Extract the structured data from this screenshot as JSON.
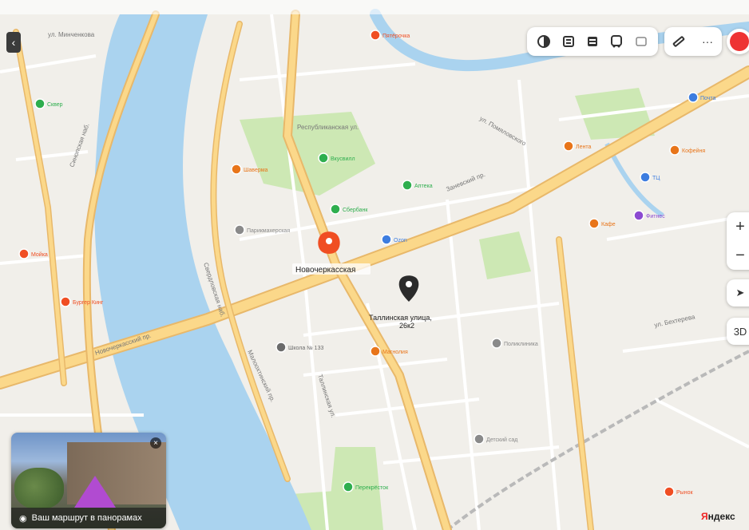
{
  "map": {
    "colors": {
      "land": "#f1efea",
      "water": "#aad3ef",
      "park": "#cde8b4",
      "road_major": "#fbd88a",
      "road_major_edge": "#e8b86a",
      "road_minor": "#ffffff",
      "rail": "#b9b9b9",
      "pin_red": "#f04e23",
      "pin_black": "#2b2b2b"
    },
    "streets": [
      {
        "name": "ул. Минченкова"
      },
      {
        "name": "Республиканская ул."
      },
      {
        "name": "Заневский пр."
      },
      {
        "name": "Новочеркасский пр."
      },
      {
        "name": "Синопская наб."
      },
      {
        "name": "Свердловская наб."
      },
      {
        "name": "Малоохтинский пр."
      },
      {
        "name": "ул. Помяловского"
      },
      {
        "name": "Таллинская ул."
      },
      {
        "name": "ул. Бехтерева"
      }
    ],
    "places": [
      {
        "label": "Бургер Кинг",
        "icon": "burger-icon",
        "color": "#f04e23"
      },
      {
        "label": "Мойка",
        "icon": "pin-icon",
        "color": "#f04e23"
      },
      {
        "label": "Шаверма",
        "icon": "pin-icon",
        "color": "#e8751a"
      },
      {
        "label": "Вкусвилл",
        "icon": "cart-icon",
        "color": "#2eae4e"
      },
      {
        "label": "Ozon",
        "icon": "box-icon",
        "color": "#3d7de0"
      },
      {
        "label": "Магнолия",
        "icon": "pin-icon",
        "color": "#e8751a"
      },
      {
        "label": "Лента",
        "icon": "cart-icon",
        "color": "#e8751a"
      },
      {
        "label": "Сбербанк",
        "icon": "bank-icon",
        "color": "#2eae4e"
      },
      {
        "label": "Пятёрочка",
        "icon": "cart-icon",
        "color": "#f04e23"
      },
      {
        "label": "Школа № 133",
        "icon": "school-icon",
        "color": "#6b6b6b"
      },
      {
        "label": "Детский сад",
        "icon": "pin-icon",
        "color": "#8a8a8a"
      },
      {
        "label": "Перекрёсток",
        "icon": "cart-icon",
        "color": "#2eae4e"
      },
      {
        "label": "Почта",
        "icon": "mail-icon",
        "color": "#3d7de0"
      },
      {
        "label": "Аптека",
        "icon": "pharmacy-icon",
        "color": "#2eae4e"
      },
      {
        "label": "Поликлиника",
        "icon": "hospital-icon",
        "color": "#8a8a8a"
      },
      {
        "label": "Парикмахерская",
        "icon": "scissors-icon",
        "color": "#8a8a8a"
      },
      {
        "label": "Сквер",
        "icon": "tree-icon",
        "color": "#2eae4e"
      },
      {
        "label": "Кофейня",
        "icon": "cup-icon",
        "color": "#e8751a"
      },
      {
        "label": "ТЦ",
        "icon": "bag-icon",
        "color": "#3d7de0"
      },
      {
        "label": "Фитнес",
        "icon": "fitness-icon",
        "color": "#8c4ad1"
      },
      {
        "label": "Рынок",
        "icon": "pin-icon",
        "color": "#f04e23"
      },
      {
        "label": "Кафе",
        "icon": "cup-icon",
        "color": "#e8751a"
      }
    ],
    "metro_label": "Новочеркасская",
    "selected_label_line1": "Таллинская улица,",
    "selected_label_line2": "26к2"
  },
  "toolbar": {
    "buttons": [
      {
        "name": "layers-icon"
      },
      {
        "name": "traffic-icon"
      },
      {
        "name": "parking-icon"
      },
      {
        "name": "transport-icon"
      },
      {
        "name": "panorama-icon"
      }
    ]
  },
  "tools": [
    {
      "name": "ruler-icon"
    },
    {
      "name": "more-icon",
      "label": "···"
    }
  ],
  "controls": {
    "collapse_label": "‹",
    "zoom_in": "+",
    "zoom_out": "−",
    "locate_label": "➤",
    "three_d_label": "3D"
  },
  "panorama": {
    "caption": "Ваш маршрут в панорамах",
    "close_label": "×"
  },
  "logo": {
    "letter": "Я",
    "rest": "ндекс"
  }
}
